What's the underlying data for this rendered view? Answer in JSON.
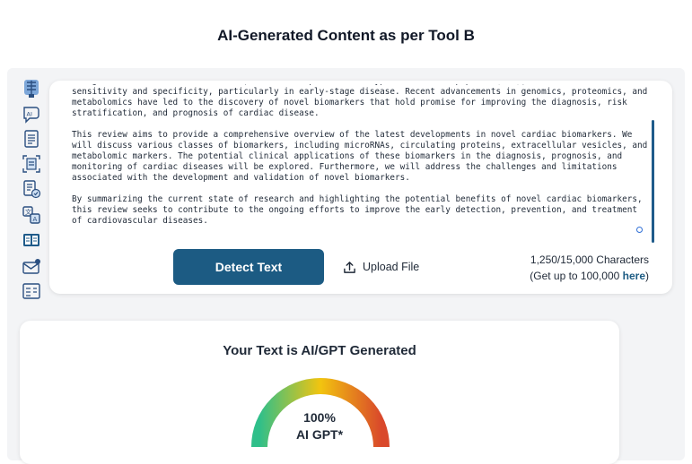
{
  "page": {
    "title": "AI-Generated Content as per Tool B"
  },
  "sidebar": {
    "icons": [
      "brain-icon",
      "ai-chat-icon",
      "document-icon",
      "scan-document-icon",
      "edit-document-icon",
      "translate-icon",
      "compare-icon",
      "mail-icon",
      "settings-list-icon"
    ]
  },
  "editor": {
    "paragraphs": [
      "management. Traditional biomarkers, such as troponin and B-type natriuretic peptide (BNP), have limitations in sensitivity and specificity, particularly in early-stage disease. Recent advancements in genomics, proteomics, and metabolomics have led to the discovery of novel biomarkers that hold promise for improving the diagnosis, risk stratification, and prognosis of cardiac disease.",
      "This review aims to provide a comprehensive overview of the latest developments in novel cardiac biomarkers. We will discuss various classes of biomarkers, including microRNAs, circulating proteins, extracellular vesicles, and metabolomic markers. The potential clinical applications of these biomarkers in the diagnosis, prognosis, and monitoring of cardiac diseases will be explored. Furthermore, we will address the challenges and limitations associated with the development and validation of novel biomarkers.",
      "By summarizing the current state of research and highlighting the potential benefits of novel cardiac biomarkers, this review seeks to contribute to the ongoing efforts to improve the early detection, prevention, and treatment of cardiovascular diseases."
    ],
    "detect_label": "Detect Text",
    "upload_label": "Upload File",
    "char_count": "1,250/15,000 Characters",
    "upgrade_prefix": "(Get up to 100,000 ",
    "upgrade_link": "here",
    "upgrade_suffix": ")"
  },
  "result": {
    "title": "Your Text is AI/GPT Generated",
    "percent_text": "100%",
    "percent_value": 100,
    "label": "AI GPT*"
  },
  "colors": {
    "accent": "#1c5b83",
    "gauge_low": "#2fbf8a",
    "gauge_mid": "#f2c40f",
    "gauge_high": "#d9482b"
  }
}
